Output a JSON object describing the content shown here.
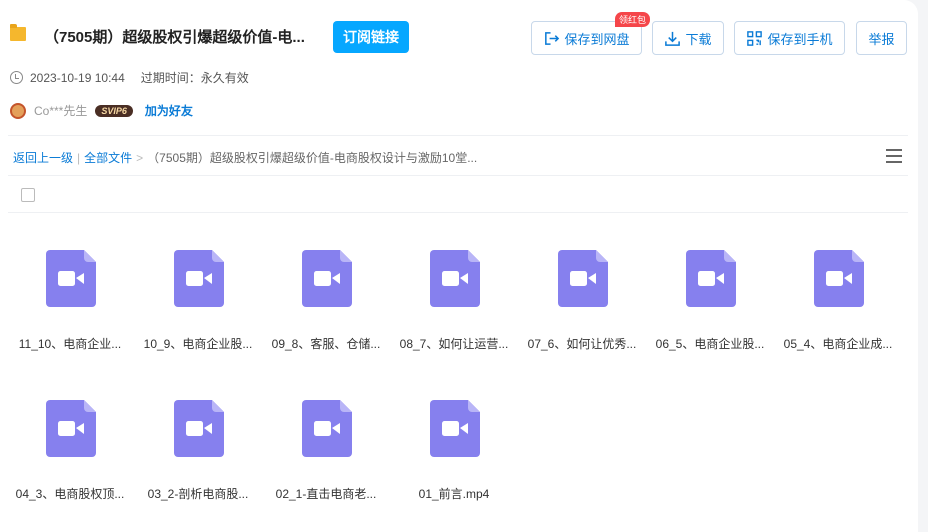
{
  "header": {
    "title": "（7505期）超级股权引爆超级价值-电...",
    "subscribe_label": "订阅链接",
    "save_netdisk_label": "保存到网盘",
    "red_badge": "领红包",
    "download_label": "下载",
    "save_phone_label": "保存到手机",
    "report_label": "举报"
  },
  "meta": {
    "datetime": "2023-10-19 10:44",
    "expire": "过期时间：永久有效"
  },
  "user": {
    "name": "Co***先生",
    "vip": "SVIP6",
    "add_friend": "加为好友"
  },
  "breadcrumb": {
    "back": "返回上一级",
    "sep1": "|",
    "all_files": "全部文件",
    "sep2": ">",
    "current": "（7505期）超级股权引爆超级价值-电商股权设计与激励10堂..."
  },
  "colors": {
    "accent": "#06a7ff",
    "link": "#0a7bd6",
    "video_icon": "#8680ee",
    "red_badge": "#f5464a"
  },
  "files": [
    {
      "name": "11_10、电商企业...",
      "icon": "video-file-icon"
    },
    {
      "name": "10_9、电商企业股...",
      "icon": "video-file-icon"
    },
    {
      "name": "09_8、客服、仓储...",
      "icon": "video-file-icon"
    },
    {
      "name": "08_7、如何让运营...",
      "icon": "video-file-icon"
    },
    {
      "name": "07_6、如何让优秀...",
      "icon": "video-file-icon"
    },
    {
      "name": "06_5、电商企业股...",
      "icon": "video-file-icon"
    },
    {
      "name": "05_4、电商企业成...",
      "icon": "video-file-icon"
    },
    {
      "name": "04_3、电商股权顶...",
      "icon": "video-file-icon"
    },
    {
      "name": "03_2-剖析电商股...",
      "icon": "video-file-icon"
    },
    {
      "name": "02_1-直击电商老...",
      "icon": "video-file-icon"
    },
    {
      "name": "01_前言.mp4",
      "icon": "video-file-icon"
    }
  ]
}
